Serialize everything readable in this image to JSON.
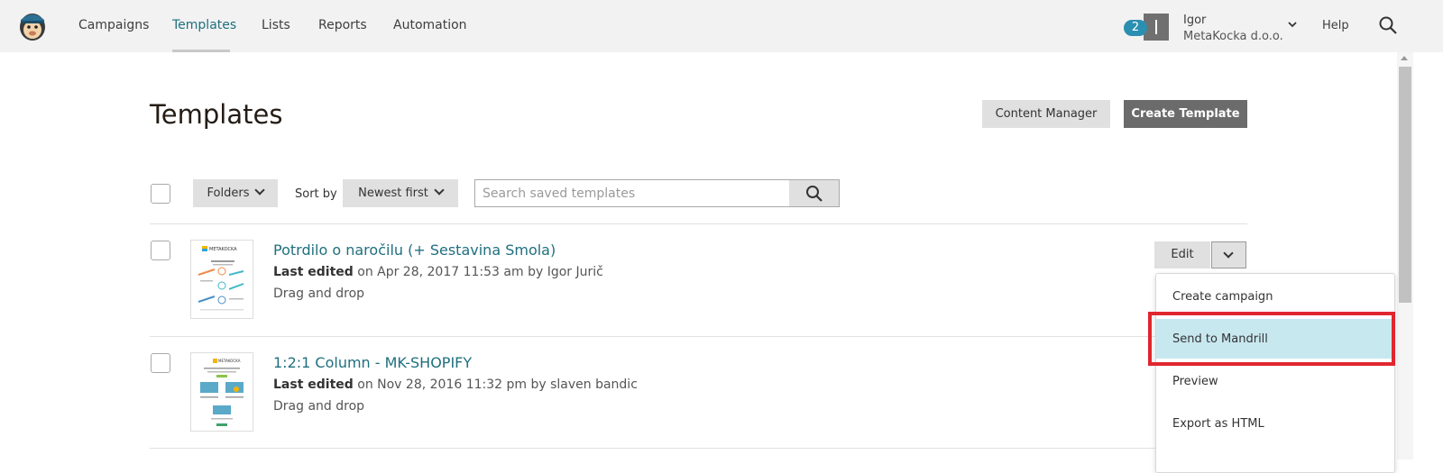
{
  "nav": {
    "items": [
      {
        "label": "Campaigns"
      },
      {
        "label": "Templates"
      },
      {
        "label": "Lists"
      },
      {
        "label": "Reports"
      },
      {
        "label": "Automation"
      }
    ],
    "active": "Templates",
    "notification_count": "2",
    "user_name": "Igor",
    "user_org": "MetaKocka d.o.o.",
    "help_label": "Help"
  },
  "header": {
    "title": "Templates",
    "content_manager_label": "Content Manager",
    "create_template_label": "Create Template"
  },
  "toolbar": {
    "folders_label": "Folders",
    "sort_by_label": "Sort by",
    "sort_value": "Newest first",
    "search_placeholder": "Search saved templates"
  },
  "templates": [
    {
      "title": "Potrdilo o naročilu (+ Sestavina Smola)",
      "last_edited_label": "Last edited",
      "edited_text": "on Apr 28, 2017 11:53 am by Igor Jurič",
      "type": "Drag and drop",
      "thumb_brand": "METAKOCKA"
    },
    {
      "title": "1:2:1 Column - MK-SHOPIFY",
      "last_edited_label": "Last edited",
      "edited_text": "on Nov 28, 2016 11:32 pm by slaven bandic",
      "type": "Drag and drop",
      "thumb_brand": "METAKOCKA"
    }
  ],
  "row_actions": {
    "edit_label": "Edit"
  },
  "dropdown": {
    "items": [
      {
        "label": "Create campaign"
      },
      {
        "label": "Send to Mandrill"
      },
      {
        "label": "Preview"
      },
      {
        "label": "Export as HTML"
      }
    ],
    "highlighted": "Send to Mandrill"
  },
  "colors": {
    "accent_link": "#1f6f7e",
    "badge": "#2a8fb0",
    "highlight": "#c8e8f0",
    "annotation_red": "#e0262f"
  }
}
